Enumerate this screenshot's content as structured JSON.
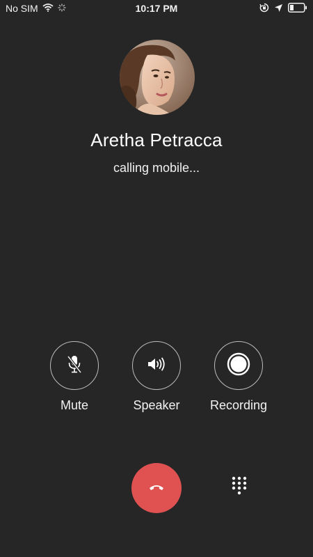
{
  "status_bar": {
    "carrier": "No SIM",
    "time": "10:17 PM"
  },
  "contact": {
    "name": "Aretha Petracca",
    "call_status": "calling mobile..."
  },
  "actions": [
    {
      "label": "Mute",
      "icon": "mic-off-icon"
    },
    {
      "label": "Speaker",
      "icon": "speaker-icon"
    },
    {
      "label": "Recording",
      "icon": "record-icon"
    }
  ],
  "controls": {
    "end_call_icon": "phone-hangup-icon",
    "keypad_icon": "dialpad-icon"
  },
  "colors": {
    "background": "#262626",
    "end_call": "#e05252",
    "text": "#ffffff"
  }
}
